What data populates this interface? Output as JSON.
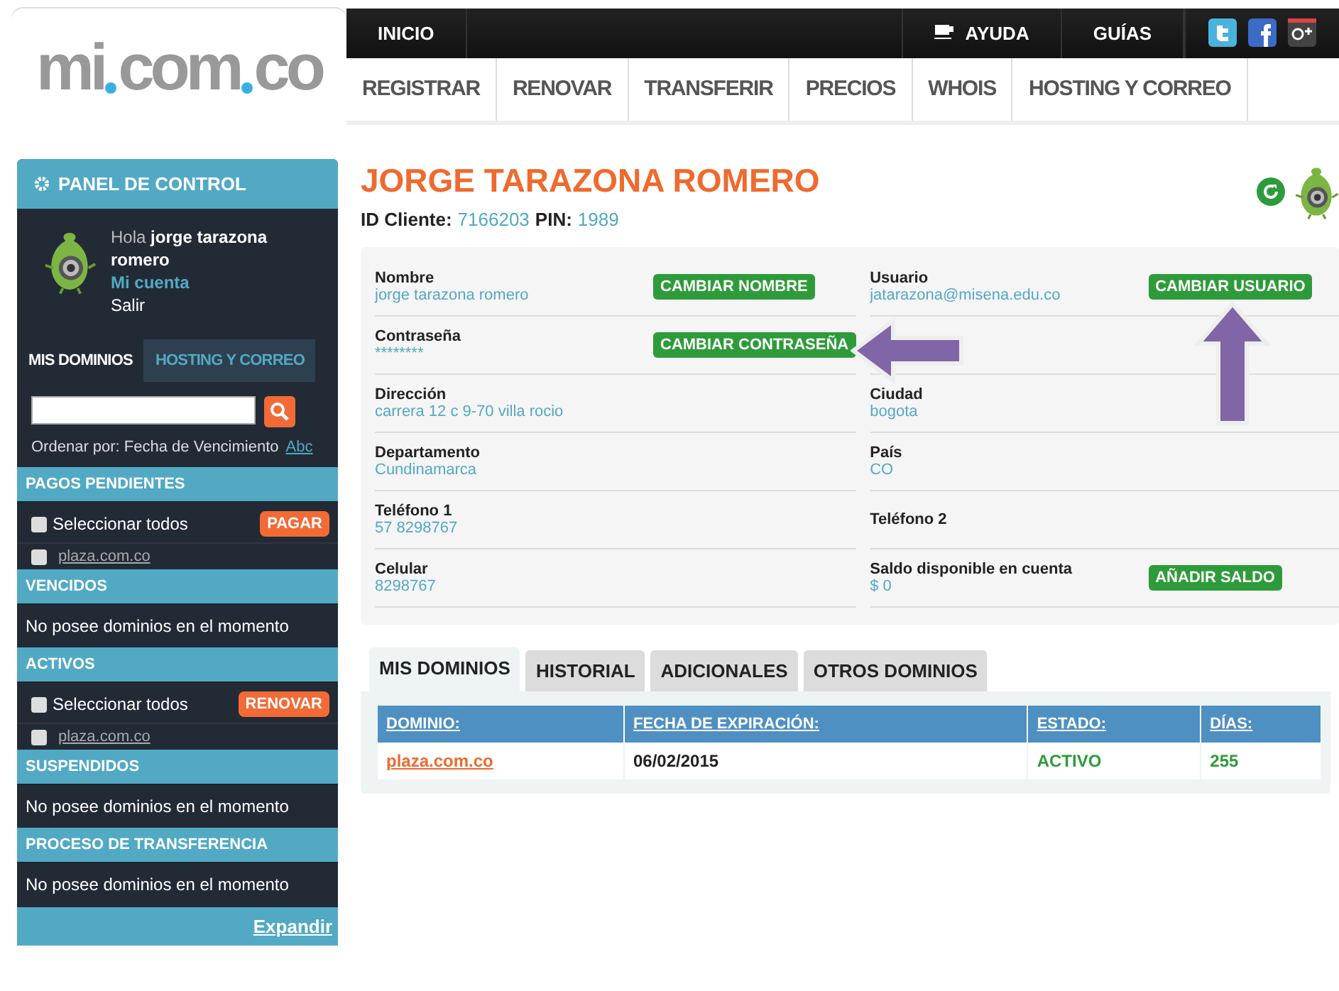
{
  "logo": {
    "parts": [
      "mi",
      "com",
      "co"
    ]
  },
  "top_nav": [
    {
      "label": "INICIO",
      "kind": "text"
    },
    {
      "label": "AYUDA",
      "kind": "cup"
    },
    {
      "label": "GUÍAS",
      "kind": "text"
    }
  ],
  "main_nav": [
    "REGISTRAR",
    "RENOVAR",
    "TRANSFERIR",
    "PRECIOS",
    "WHOIS",
    "HOSTING Y CORREO"
  ],
  "sidebar": {
    "title": "PANEL DE CONTROL",
    "greeting": "Hola",
    "user": "jorge tarazona romero",
    "account_link": "Mi cuenta",
    "logout": "Salir",
    "tabs": [
      {
        "label": "MIS DOMINIOS",
        "selected": true
      },
      {
        "label": "HOSTING Y CORREO",
        "selected": false
      }
    ],
    "sort_label": "Ordenar por: Fecha de Vencimiento",
    "sort_link": "Abc",
    "sections": [
      {
        "title": "PAGOS PENDIENTES",
        "kind": "list",
        "select_all": "Seleccionar todos",
        "select_all_checked": false,
        "action": "PAGAR",
        "items": [
          {
            "domain": "plaza.com.co",
            "checked": false
          }
        ]
      },
      {
        "title": "VENCIDOS",
        "kind": "empty",
        "message": "No posee dominios en el momento"
      },
      {
        "title": "ACTIVOS",
        "kind": "list",
        "select_all": "Seleccionar todos",
        "select_all_checked": false,
        "action": "RENOVAR",
        "items": [
          {
            "domain": "plaza.com.co",
            "checked": false
          }
        ]
      },
      {
        "title": "SUSPENDIDOS",
        "kind": "empty",
        "message": "No posee dominios en el momento"
      },
      {
        "title": "PROCESO DE TRANSFERENCIA",
        "kind": "empty",
        "message": "No posee dominios en el momento"
      }
    ],
    "expand": "Expandir"
  },
  "profile": {
    "name": "JORGE TARAZONA ROMERO",
    "client_id_label": "ID Cliente:",
    "client_id": "7166203",
    "pin_label": "PIN:",
    "pin": "1989"
  },
  "fields": [
    [
      {
        "label": "Nombre",
        "value": "jorge tarazona romero",
        "button": "CAMBIAR NOMBRE"
      },
      {
        "label": "Usuario",
        "value": "jatarazona@misena.edu.co",
        "button": "CAMBIAR USUARIO"
      }
    ],
    [
      {
        "label": "Contraseña",
        "value": "********",
        "button": "CAMBIAR CONTRASEÑA"
      }
    ],
    [
      {
        "label": "Dirección",
        "value": "carrera 12 c 9-70 villa rocio"
      },
      {
        "label": "Ciudad",
        "value": "bogota"
      }
    ],
    [
      {
        "label": "Departamento",
        "value": "Cundinamarca"
      },
      {
        "label": "País",
        "value": "CO"
      }
    ],
    [
      {
        "label": "Teléfono 1",
        "value": "57 8298767"
      },
      {
        "label": "Teléfono 2"
      }
    ],
    [
      {
        "label": "Celular",
        "value": "8298767"
      },
      {
        "label": "Saldo disponible en cuenta",
        "value": "$ 0",
        "button": "AÑADIR SALDO"
      }
    ]
  ],
  "domain_tabs": [
    {
      "label": "MIS DOMINIOS",
      "selected": true
    },
    {
      "label": "HISTORIAL",
      "selected": false
    },
    {
      "label": "ADICIONALES",
      "selected": false
    },
    {
      "label": "OTROS DOMINIOS",
      "selected": false
    }
  ],
  "table": {
    "columns": [
      "DOMINIO:",
      "FECHA DE EXPIRACIÓN:",
      "ESTADO:",
      "DÍAS:"
    ],
    "rows": [
      {
        "domain": "plaza.com.co",
        "expires": "06/02/2015",
        "status": "ACTIVO",
        "days": "255"
      }
    ]
  }
}
